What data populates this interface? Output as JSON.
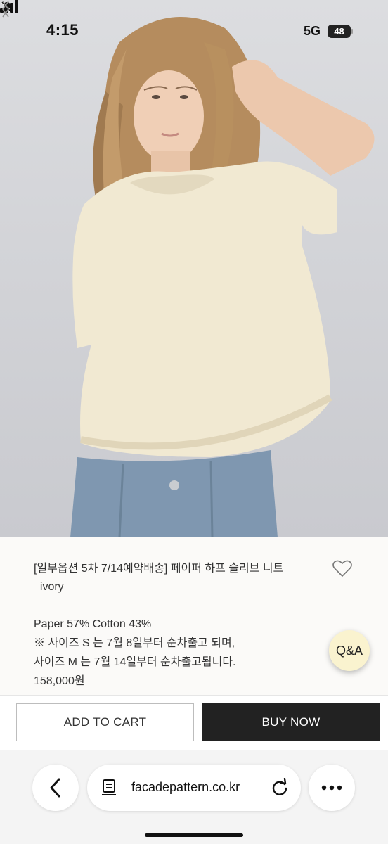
{
  "status_bar": {
    "time": "4:15",
    "network": "5G",
    "battery": "48"
  },
  "product": {
    "title_line1": "[일부옵션 5차 7/14예약배송] 페이퍼 하프 슬리브 니트",
    "title_line2": "_ivory",
    "material": "Paper 57% Cotton 43%",
    "note_line1": "※ 사이즈 S 는 7월 8일부터 순차출고 되며,",
    "note_line2": "사이즈 M 는 7월 14일부터 순차출고됩니다.",
    "price": "158,000원"
  },
  "floating": {
    "qa_label": "Q&A"
  },
  "actions": {
    "add_to_cart": "ADD TO CART",
    "buy_now": "BUY NOW"
  },
  "browser": {
    "url": "facadepattern.co.kr"
  },
  "colors": {
    "buy_button": "#222222",
    "qa_badge": "#faf3cf",
    "page_bg": "#fbfaf8"
  },
  "icons": [
    "bell-slash-icon",
    "signal-icon",
    "chevron-left-icon",
    "chevron-right-icon",
    "heart-icon",
    "back-icon",
    "page-icon",
    "reload-icon",
    "more-icon"
  ]
}
